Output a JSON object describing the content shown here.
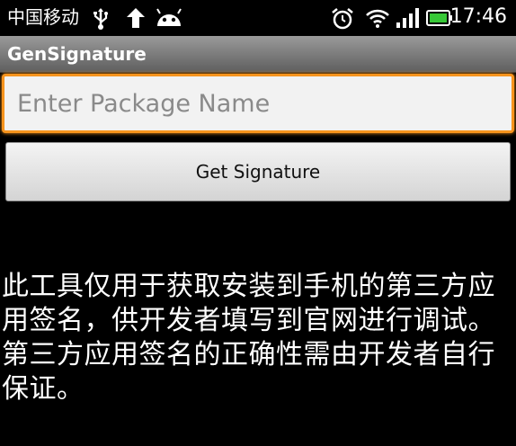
{
  "status_bar": {
    "carrier": "中国移动",
    "time": "17:46",
    "icons": [
      "usb-icon",
      "upload-icon",
      "android-icon",
      "alarm-icon",
      "wifi-icon",
      "signal-icon",
      "battery-icon"
    ]
  },
  "app": {
    "title": "GenSignature"
  },
  "form": {
    "package_placeholder": "Enter Package Name",
    "package_value": "",
    "button_label": "Get Signature"
  },
  "description": "此工具仅用于获取安装到手机的第三方应用签名，供开发者填写到官网进行调试。第三方应用签名的正确性需由开发者自行保证。",
  "colors": {
    "focus_border": "#f7941d",
    "battery": "#37c837"
  }
}
